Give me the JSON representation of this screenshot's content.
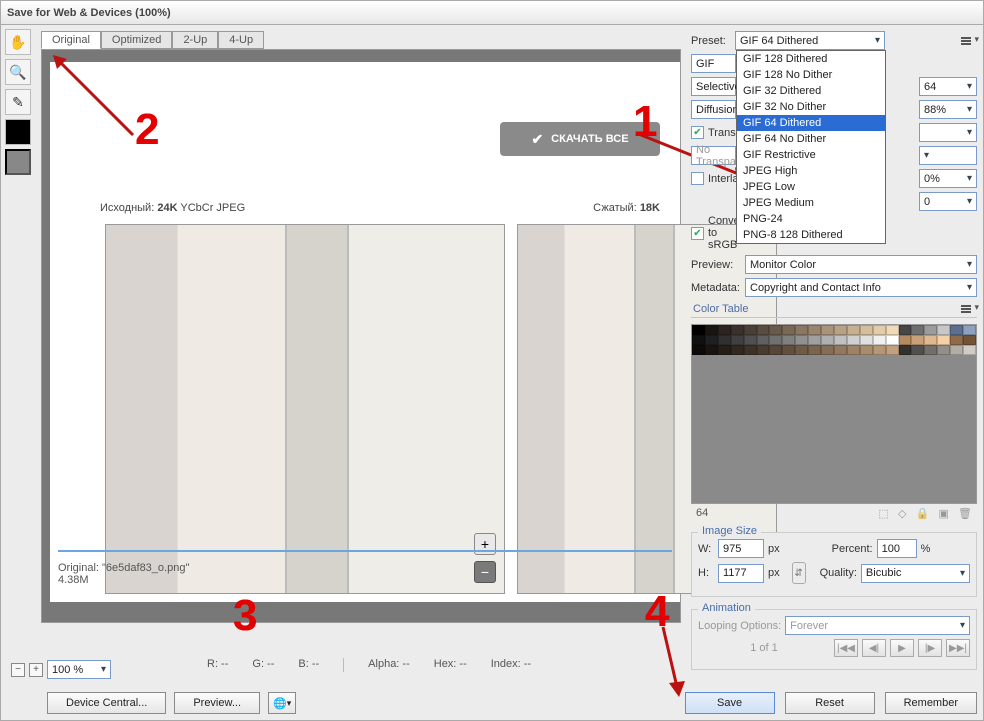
{
  "window": {
    "title": "Save for Web & Devices (100%)"
  },
  "tabs": {
    "t0": "Original",
    "t1": "Optimized",
    "t2": "2-Up",
    "t3": "4-Up"
  },
  "overlay": {
    "download": "СКАЧАТЬ ВСЕ",
    "src_label": "Исходный:",
    "src_size": "24K",
    "src_fmt": "YCbCr JPEG",
    "cmp_label": "Сжатый:",
    "cmp_size": "18K"
  },
  "footer": {
    "line1": "Original: \"6e5daf83_o.png\"",
    "line2": "4.38M"
  },
  "readouts": {
    "r": "R: --",
    "g": "G: --",
    "b": "B: --",
    "alpha": "Alpha: --",
    "hex": "Hex: --",
    "index": "Index: --"
  },
  "zoom": "100 %",
  "buttons": {
    "devicecentral": "Device Central...",
    "preview": "Preview...",
    "save": "Save",
    "reset": "Reset",
    "remember": "Remember"
  },
  "preset": {
    "label": "Preset:",
    "value": "GIF 64 Dithered",
    "options": {
      "o0": "GIF 128 Dithered",
      "o1": "GIF 128 No Dither",
      "o2": "GIF 32 Dithered",
      "o3": "GIF 32 No Dither",
      "o4": "GIF 64 Dithered",
      "o5": "GIF 64 No Dither",
      "o6": "GIF Restrictive",
      "o7": "JPEG High",
      "o8": "JPEG Low",
      "o9": "JPEG Medium",
      "o10": "PNG-24",
      "o11": "PNG-8 128 Dithered"
    }
  },
  "settings": {
    "format": "GIF",
    "reduction_lbl": "Selective",
    "reduction_colors": "64",
    "dither_lbl": "Diffusion",
    "dither_amt": "88%",
    "transparency_lbl": "Transparency",
    "transparency_chk": true,
    "notrans_lbl": "No Transparency",
    "interlaced_lbl": "Interlaced",
    "interlaced_chk": false,
    "lossy": "0%",
    "websnap": "0",
    "convert_lbl": "Convert to sRGB",
    "convert_chk": true,
    "preview_lbl": "Preview:",
    "preview_val": "Monitor Color",
    "metadata_lbl": "Metadata:",
    "metadata_val": "Copyright and Contact Info"
  },
  "colortable": {
    "title": "Color Table",
    "count": "64",
    "colors": [
      "#000000",
      "#1a1412",
      "#2b2420",
      "#3a312c",
      "#4a3f37",
      "#5a4c41",
      "#6a5a4c",
      "#7a6857",
      "#8a7662",
      "#9a856e",
      "#a9937a",
      "#b8a286",
      "#c7b092",
      "#d5be9e",
      "#e3ccab",
      "#f1dab8",
      "#474747",
      "#6e6e6e",
      "#9b9b9b",
      "#c7c7c7",
      "#5d6f90",
      "#8da1bf",
      "#101010",
      "#202020",
      "#303030",
      "#404040",
      "#505050",
      "#606060",
      "#707070",
      "#808080",
      "#909090",
      "#a0a0a0",
      "#b0b0b0",
      "#c0c0c0",
      "#d0d0d0",
      "#e0e0e0",
      "#f0f0f0",
      "#ffffff",
      "#b48a60",
      "#caa078",
      "#e0b890",
      "#f5d0a8",
      "#8e6b4a",
      "#715339",
      "#0d0a08",
      "#19140f",
      "#251e17",
      "#31281f",
      "#3d3227",
      "#493c2f",
      "#554637",
      "#61503f",
      "#6d5a47",
      "#79644f",
      "#856e57",
      "#91785f",
      "#9d8267",
      "#a98c6f",
      "#b59677",
      "#c1a07f",
      "#33312e",
      "#52504c",
      "#726f6a",
      "#928e88",
      "#b2ada6",
      "#d2ccc4"
    ]
  },
  "imagesize": {
    "title": "Image Size",
    "w_lbl": "W:",
    "w": "975",
    "h_lbl": "H:",
    "h": "1177",
    "px": "px",
    "percent_lbl": "Percent:",
    "percent": "100",
    "pct": "%",
    "quality_lbl": "Quality:",
    "quality": "Bicubic"
  },
  "animation": {
    "title": "Animation",
    "loop_lbl": "Looping Options:",
    "loop": "Forever",
    "pager": "1 of 1"
  }
}
